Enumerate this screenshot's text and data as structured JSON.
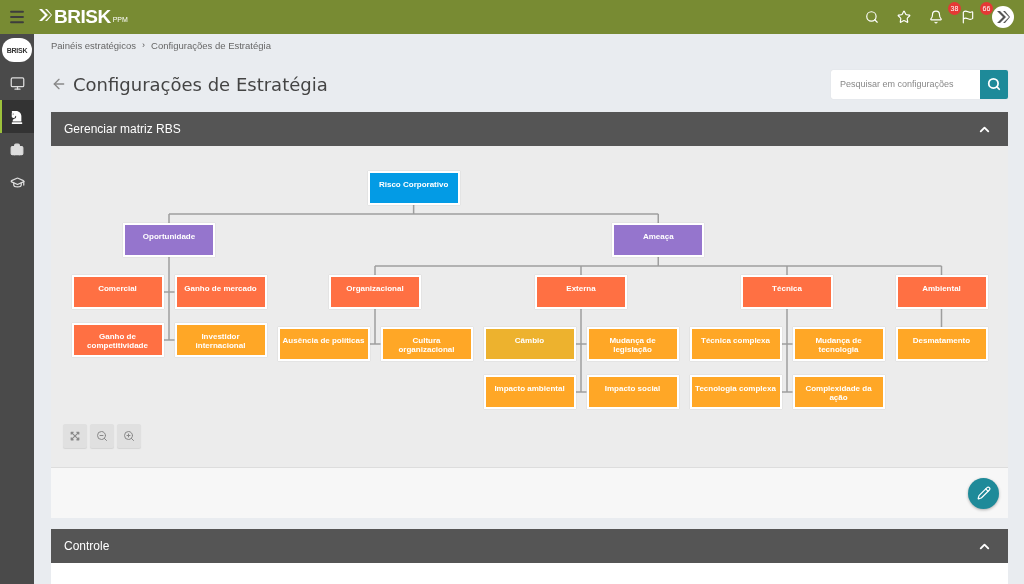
{
  "topbar": {
    "logo_text": "BRISK",
    "logo_suffix": "PPM",
    "notifications": "38",
    "flags": "66"
  },
  "sidebar": {
    "logo_text": "BRISK",
    "items": [
      {
        "kind": "monitor",
        "selected": false
      },
      {
        "kind": "knight",
        "selected": true
      },
      {
        "kind": "briefcase",
        "selected": false
      },
      {
        "kind": "graduation",
        "selected": false
      }
    ]
  },
  "breadcrumb": [
    "Painéis estratégicos",
    "Configurações de Estratégia"
  ],
  "breadcrumb_separator": "›",
  "page_title": "Configurações de Estratégia",
  "search": {
    "placeholder": "Pesquisar em configurações"
  },
  "panels": [
    {
      "title": "Gerenciar matriz RBS",
      "expanded": true
    },
    {
      "title": "Controle",
      "expanded": true
    }
  ],
  "diagram": {
    "root": {
      "label": "Risco Corporativo",
      "color": "#039be5",
      "children": [
        {
          "label": "Oportunidade",
          "color": "#9575cd",
          "children": [
            {
              "label": "Comercial",
              "color": "#ff7043"
            },
            {
              "label": "Ganho de mercado",
              "color": "#ff7043"
            },
            {
              "label": "Ganho de competitividade",
              "color": "#ff7043"
            },
            {
              "label": "Investidor internacional",
              "color": "#ffa726"
            }
          ]
        },
        {
          "label": "Ameaça",
          "color": "#9575cd",
          "children": [
            {
              "label": "Organizacional",
              "color": "#ff7043",
              "children": [
                {
                  "label": "Ausência de políticas",
                  "color": "#ffa726"
                },
                {
                  "label": "Cultura organizacional",
                  "color": "#ffa726"
                }
              ]
            },
            {
              "label": "Externa",
              "color": "#ff7043",
              "children": [
                {
                  "label": "Câmbio",
                  "color": "#edb22e"
                },
                {
                  "label": "Mudança de legislação",
                  "color": "#ffa726"
                },
                {
                  "label": "Impacto ambiental",
                  "color": "#ffa726"
                },
                {
                  "label": "Impacto social",
                  "color": "#ffa726"
                }
              ]
            },
            {
              "label": "Técnica",
              "color": "#ff7043",
              "children": [
                {
                  "label": "Técnica complexa",
                  "color": "#ffa726"
                },
                {
                  "label": "Mudança de tecnologia",
                  "color": "#ffa726"
                },
                {
                  "label": "Tecnologia complexa",
                  "color": "#ffa726"
                },
                {
                  "label": "Complexidade da ação",
                  "color": "#ffa726"
                }
              ]
            },
            {
              "label": "Ambiental",
              "color": "#ff7043",
              "children": [
                {
                  "label": "Desmatamento",
                  "color": "#ffa726"
                }
              ]
            }
          ]
        }
      ]
    }
  }
}
